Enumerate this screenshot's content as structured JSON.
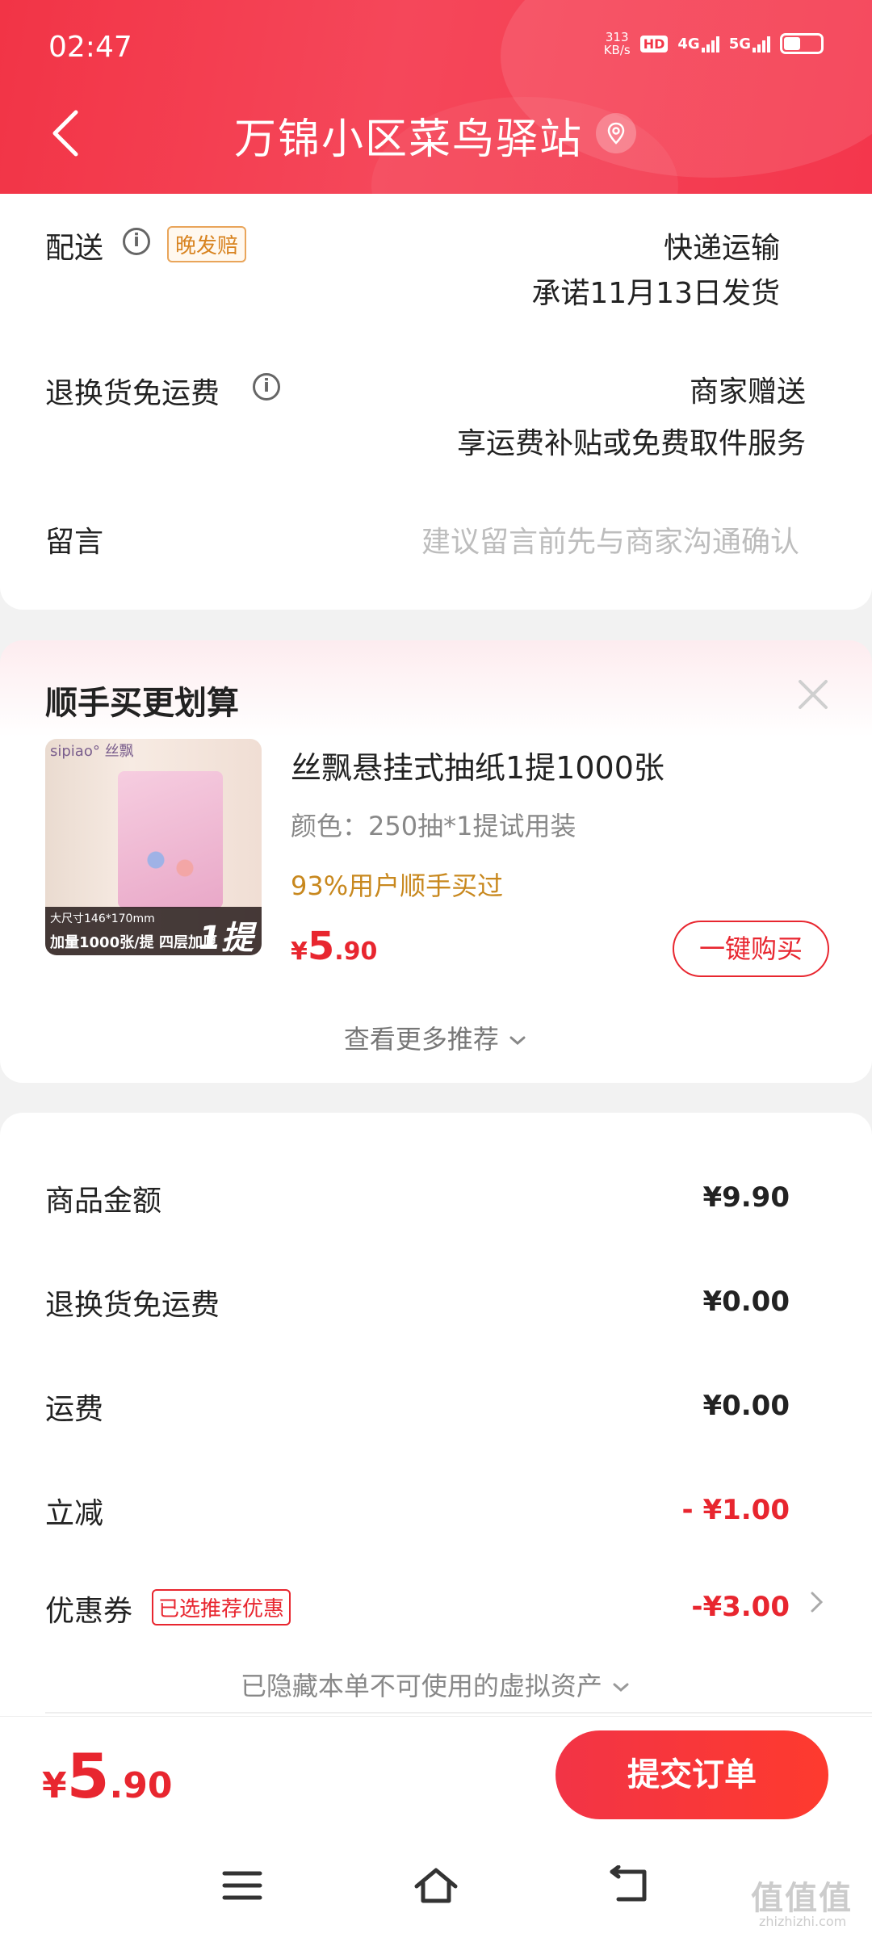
{
  "status": {
    "time": "02:47",
    "net_speed_value": "313",
    "net_speed_unit": "KB/s",
    "hd": "HD",
    "net1": "4G",
    "net2": "5G"
  },
  "header": {
    "title": "万锦小区菜鸟驿站"
  },
  "delivery": {
    "label": "配送",
    "tag": "晚发赔",
    "method": "快递运输",
    "promise": "承诺11月13日发货"
  },
  "return_shipping": {
    "label": "退换货免运费",
    "value": "商家赠送",
    "desc": "享运费补贴或免费取件服务"
  },
  "message": {
    "label": "留言",
    "placeholder": "建议留言前先与商家沟通确认"
  },
  "recommend": {
    "title": "顺手买更划算",
    "product": {
      "brand": "sipiao° 丝飘",
      "img_line1": "大尺寸146*170mm",
      "img_line2": "加量1000张/提 四层加厚",
      "img_badge": "1提",
      "name": "丝飘悬挂式抽纸1提1000张",
      "color": "颜色：250抽*1提试用装",
      "stat": "93%用户顺手买过",
      "price_currency": "¥",
      "price_int": "5",
      "price_dec": ".90",
      "buy_label": "一键购买"
    },
    "more_label": "查看更多推荐"
  },
  "costs": [
    {
      "label": "商品金额",
      "value": "¥9.90"
    },
    {
      "label": "退换货免运费",
      "value": "¥0.00"
    },
    {
      "label": "运费",
      "value": "¥0.00"
    },
    {
      "label": "立减",
      "value": "- ¥1.00"
    },
    {
      "label": "优惠券",
      "tag": "已选推荐优惠",
      "value": "-¥3.00"
    }
  ],
  "hidden_assets": "已隐藏本单不可使用的虚拟资产",
  "footer": {
    "total_currency": "¥",
    "total_int": "5",
    "total_dec": ".90",
    "submit_label": "提交订单"
  },
  "watermark": {
    "text": "值值值",
    "sub": "zhizhizhi.com"
  },
  "colors": {
    "brand_red": "#f23446",
    "price_red": "#e8262f",
    "tag_orange": "#d88320"
  }
}
